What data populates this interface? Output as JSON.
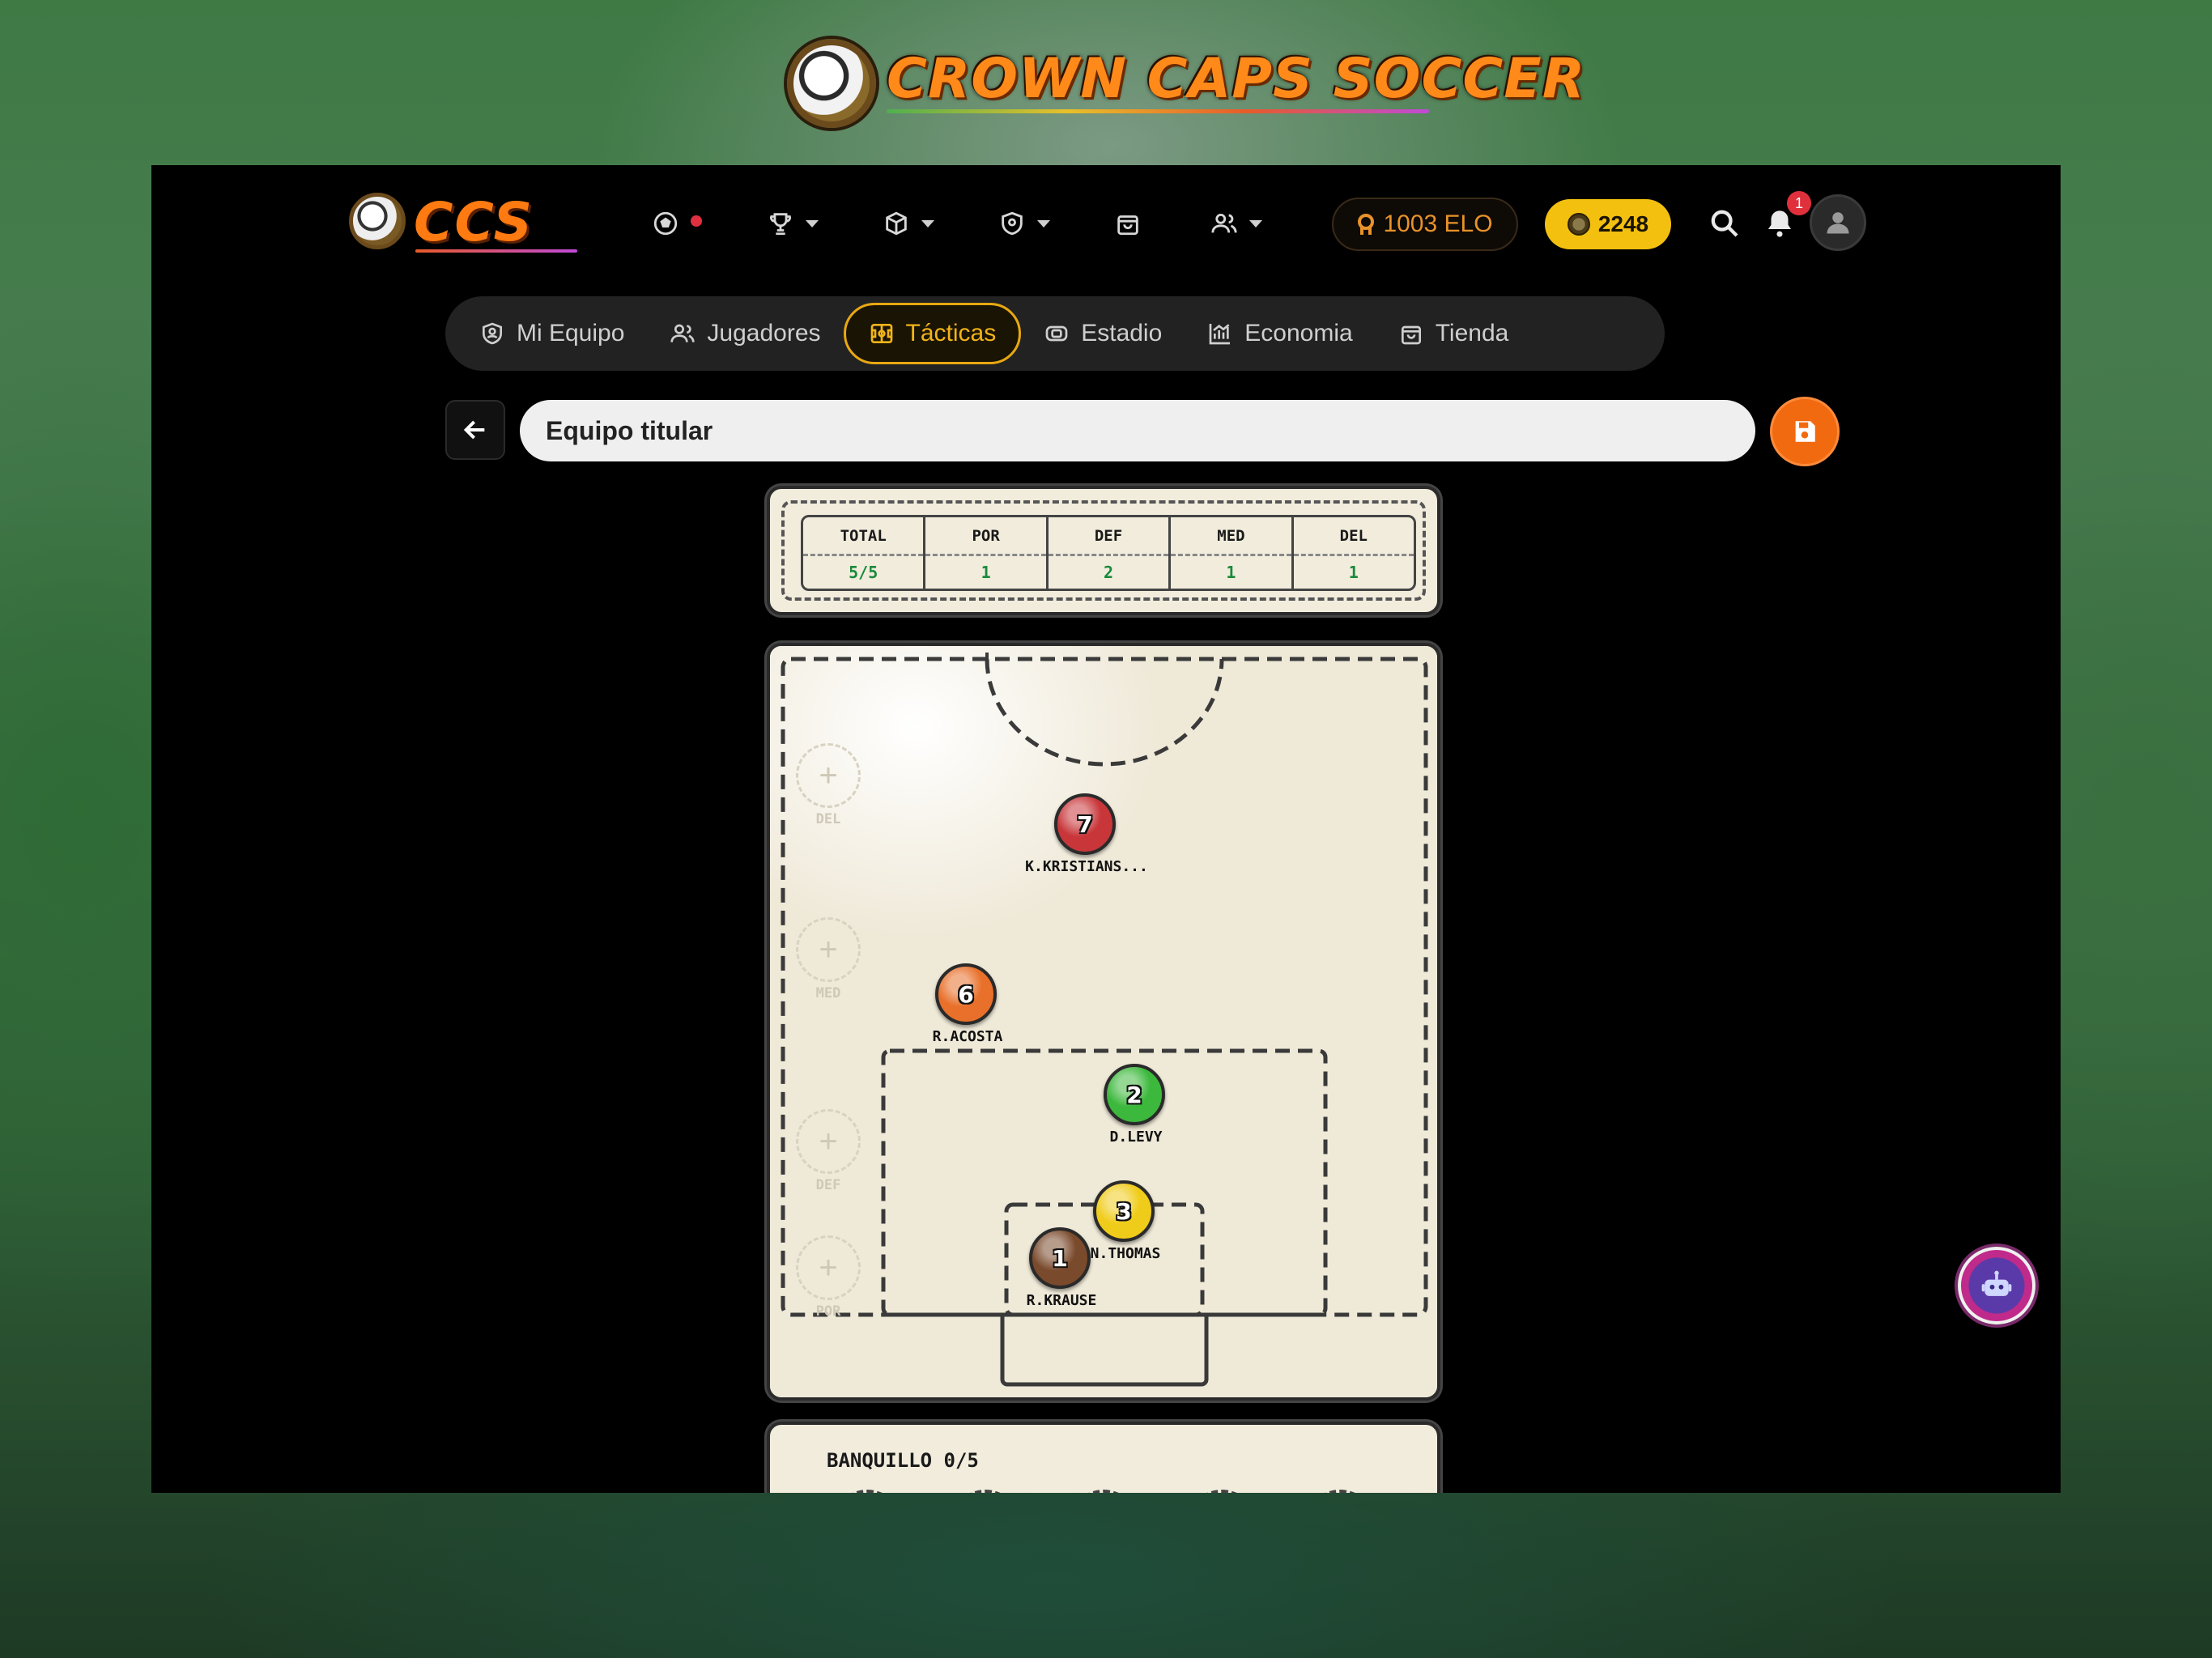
{
  "banner": {
    "title": "CROWN CAPS SOCCER"
  },
  "header": {
    "logo_text": "CCS",
    "elo": "1003 ELO",
    "coins": "2248",
    "notification_count": "1",
    "icons": [
      "soccer-ball-icon",
      "trophy-icon",
      "box-icon",
      "shield-icon",
      "bag-icon",
      "users-icon",
      "search-icon",
      "bell-icon",
      "user-icon"
    ]
  },
  "tabs": [
    {
      "label": "Mi Equipo",
      "icon": "shield-user-icon",
      "active": false
    },
    {
      "label": "Jugadores",
      "icon": "users-icon",
      "active": false
    },
    {
      "label": "Tácticas",
      "icon": "tactics-board-icon",
      "active": true
    },
    {
      "label": "Estadio",
      "icon": "stadium-icon",
      "active": false
    },
    {
      "label": "Economia",
      "icon": "chart-icon",
      "active": false
    },
    {
      "label": "Tienda",
      "icon": "bag-icon",
      "active": false
    }
  ],
  "lineup": {
    "name": "Equipo titular"
  },
  "stats": {
    "headers": [
      "TOTAL",
      "POR",
      "DEF",
      "MED",
      "DEL"
    ],
    "values": [
      "5/5",
      "1",
      "2",
      "1",
      "1"
    ]
  },
  "pitch": {
    "empty_slots": [
      "DEL",
      "MED",
      "DEF",
      "POR"
    ],
    "players": [
      {
        "number": "7",
        "name": "K.KRISTIANS...",
        "color": "#c8363a"
      },
      {
        "number": "6",
        "name": "R.ACOSTA",
        "color": "#e8702a"
      },
      {
        "number": "2",
        "name": "D.LEVY",
        "color": "#3cb83c"
      },
      {
        "number": "3",
        "name": "N.THOMAS",
        "color": "#f0cc1a"
      },
      {
        "number": "1",
        "name": "R.KRAUSE",
        "color": "#7a4a2c"
      }
    ]
  },
  "bench": {
    "title": "BANQUILLO  0/5"
  },
  "colors": {
    "accent": "#f2b418",
    "save": "#f26a10",
    "field": "#efe9d8"
  }
}
